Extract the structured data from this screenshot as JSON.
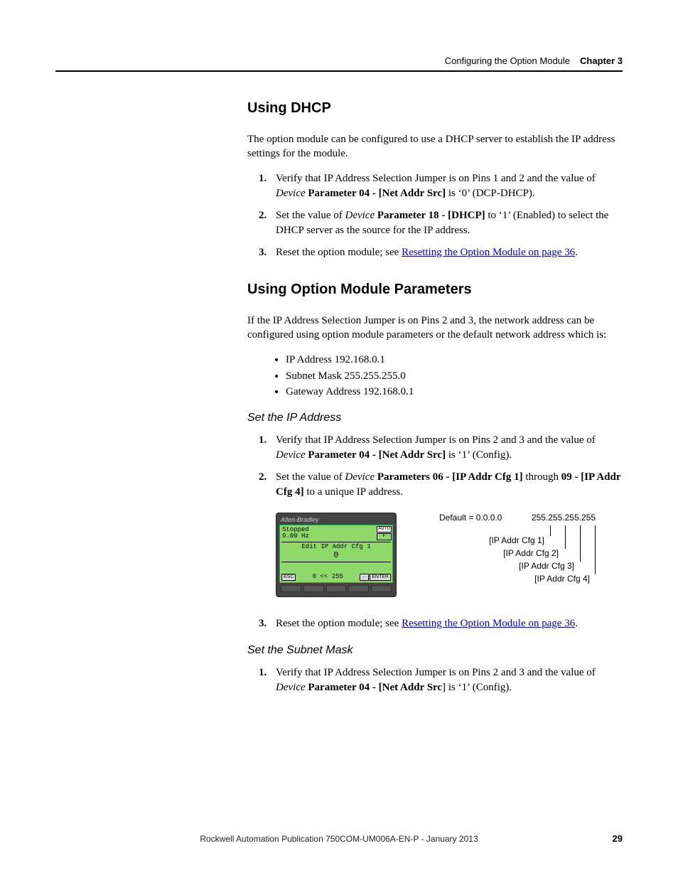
{
  "header": {
    "chapter_title": "Configuring the Option Module",
    "chapter_label": "Chapter 3"
  },
  "sec_dhcp": {
    "heading": "Using DHCP",
    "intro": "The option module can be configured to use a DHCP server to establish the IP address settings for the module.",
    "step1_a": "Verify that IP Address Selection Jumper is on Pins 1 and 2 and the value of ",
    "step1_b": "Device",
    "step1_c": " ",
    "step1_d": "Parameter 04 - [Net Addr Src]",
    "step1_e": " is ‘0’ (DCP-DHCP).",
    "step2_a": "Set the value of ",
    "step2_b": "Device",
    "step2_c": " ",
    "step2_d": "Parameter 18 - [DHCP]",
    "step2_e": " to ‘1’ (Enabled) to select the DHCP server as the source for the IP address.",
    "step3_a": "Reset the option module; see ",
    "step3_link": "Resetting the Option Module on page 36",
    "step3_b": "."
  },
  "sec_params": {
    "heading": "Using Option Module Parameters",
    "intro": "If the IP Address Selection Jumper is on Pins 2 and 3, the network address can be configured using option module parameters or the default network address which is:",
    "bullets": {
      "b1": "IP Address 192.168.0.1",
      "b2": "Subnet Mask 255.255.255.0",
      "b3": "Gateway Address 192.168.0.1"
    }
  },
  "sec_setip": {
    "heading": "Set the IP Address",
    "step1_a": "Verify that IP Address Selection Jumper is on Pins 2 and 3 and the value of ",
    "step1_b": "Device",
    "step1_c": " ",
    "step1_d": "Parameter 04 - [Net Addr Src]",
    "step1_e": " is ‘1’ (Config).",
    "step2_a": "Set the value of ",
    "step2_b": "Device",
    "step2_c": " ",
    "step2_d": "Parameters 06 - [IP Addr Cfg 1]",
    "step2_e": " through ",
    "step2_f": "09 - [IP Addr Cfg 4]",
    "step2_g": " to a unique IP address.",
    "step3_a": "Reset the option module; see ",
    "step3_link": "Resetting the Option Module on page 36",
    "step3_b": "."
  },
  "him": {
    "brand": "Allen-Bradley",
    "status": "Stopped",
    "freq": "0.00 Hz",
    "auto": "AUTO",
    "fg": "F",
    "edit": "Edit IP Addr Cfg 1",
    "zero": "0",
    "range": "0  <<  255",
    "esc": "ESC",
    "enter": "ENTER"
  },
  "ipdiag": {
    "default": "Default = 0.0.0.0",
    "max": "255.255.255.255",
    "cfg1": "[IP Addr Cfg 1]",
    "cfg2": "[IP Addr Cfg 2]",
    "cfg3": "[IP Addr Cfg 3]",
    "cfg4": "[IP Addr Cfg 4]"
  },
  "sec_subnet": {
    "heading": "Set the Subnet Mask",
    "step1_a": "Verify that IP Address Selection Jumper is on Pins 2 and 3 and the value of ",
    "step1_b": "Device",
    "step1_c": " ",
    "step1_d": "Parameter 04 - [Net Addr Src",
    "step1_e": "] is ‘1’ (Config)."
  },
  "footer": {
    "pub": "Rockwell Automation Publication 750COM-UM006A-EN-P - January 2013",
    "page": "29"
  }
}
